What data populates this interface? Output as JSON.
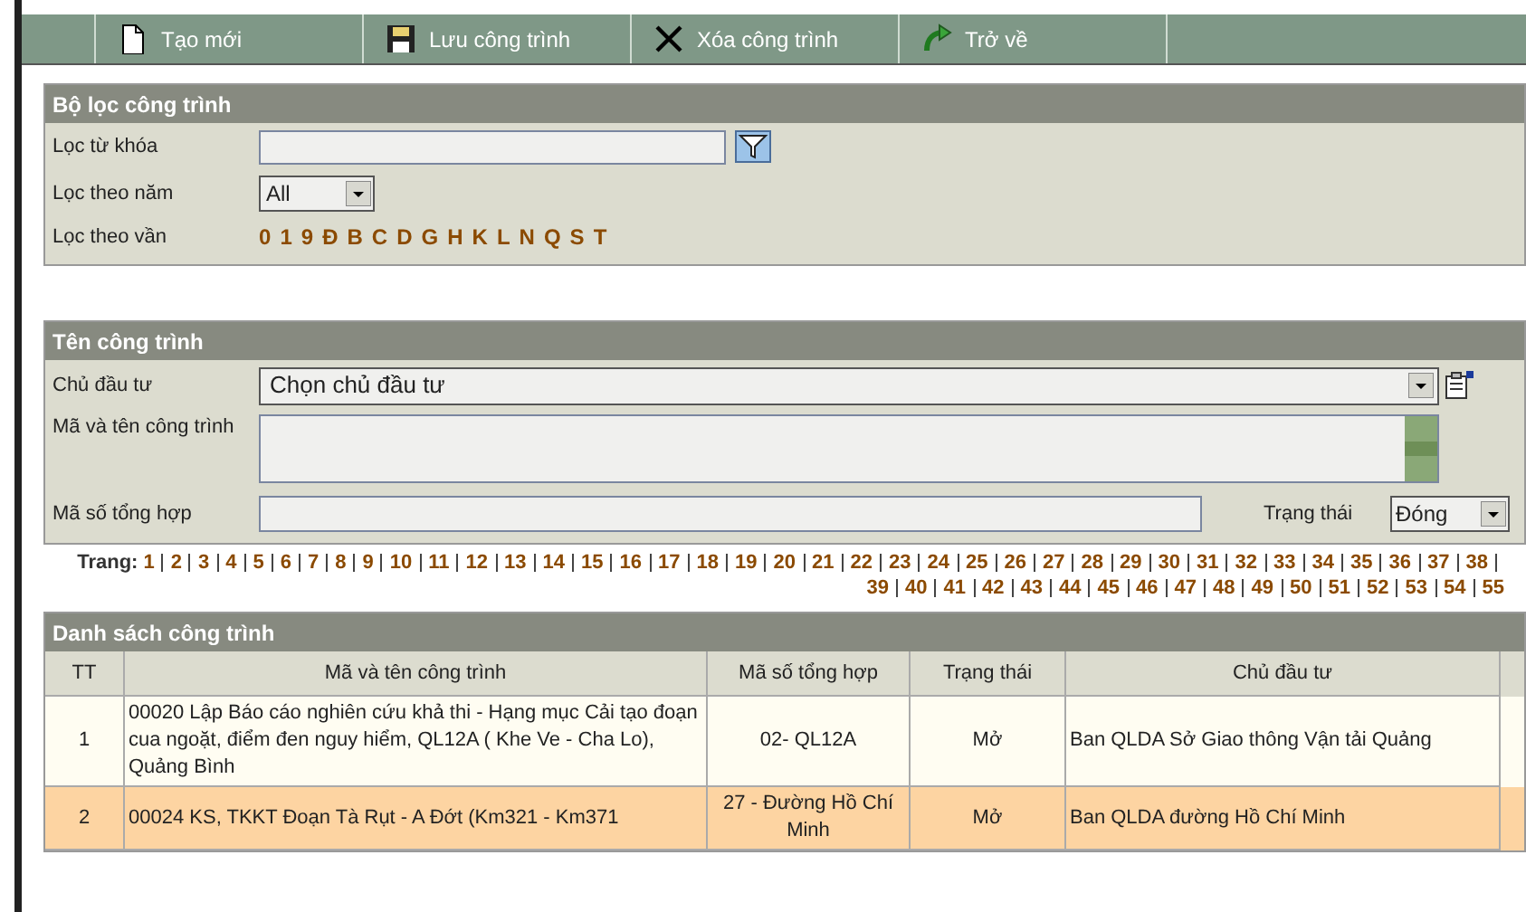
{
  "toolbar": [
    {
      "kind": "new",
      "label": "Tạo mới"
    },
    {
      "kind": "save",
      "label": "Lưu công trình"
    },
    {
      "kind": "delete",
      "label": "Xóa công trình"
    },
    {
      "kind": "back",
      "label": "Trở về"
    }
  ],
  "filter": {
    "title": "Bộ lọc công trình",
    "keyword_label": "Lọc từ khóa",
    "year_label": "Lọc theo năm",
    "year_value": "All",
    "letters_label": "Lọc theo vần",
    "letters": [
      "0",
      "1",
      "9",
      "Đ",
      "B",
      "C",
      "D",
      "G",
      "H",
      "K",
      "L",
      "N",
      "Q",
      "S",
      "T"
    ]
  },
  "project": {
    "title": "Tên công trình",
    "owner_label": "Chủ đầu tư",
    "owner_value": "Chọn chủ đầu tư",
    "name_label": "Mã và tên công trình",
    "code_label": "Mã số tổng hợp",
    "status_label": "Trạng thái",
    "status_value": "Đóng"
  },
  "pager": {
    "label": "Trang:",
    "pages": [
      "1",
      "2",
      "3",
      "4",
      "5",
      "6",
      "7",
      "8",
      "9",
      "10",
      "11",
      "12",
      "13",
      "14",
      "15",
      "16",
      "17",
      "18",
      "19",
      "20",
      "21",
      "22",
      "23",
      "24",
      "25",
      "26",
      "27",
      "28",
      "29",
      "30",
      "31",
      "32",
      "33",
      "34",
      "35",
      "36",
      "37",
      "38",
      "39",
      "40",
      "41",
      "42",
      "43",
      "44",
      "45",
      "46",
      "47",
      "48",
      "49",
      "50",
      "51",
      "52",
      "53",
      "54",
      "55"
    ]
  },
  "table": {
    "title": "Danh sách công trình",
    "columns": [
      "TT",
      "Mã và tên công trình",
      "Mã số tổng hợp",
      "Trạng thái",
      "Chủ đầu tư"
    ],
    "rows": [
      {
        "selected": false,
        "cells": [
          "1",
          "00020 Lập Báo cáo nghiên cứu khả thi - Hạng mục Cải tạo đoạn cua ngoặt, điểm đen nguy hiểm, QL12A ( Khe Ve - Cha Lo), Quảng Bình",
          "02- QL12A",
          "Mở",
          "Ban QLDA Sở Giao thông Vận tải Quảng"
        ]
      },
      {
        "selected": true,
        "cells": [
          "2",
          "00024 KS, TKKT Đoạn Tà Rụt - A Đớt (Km321 - Km371",
          "27 - Đường Hồ Chí Minh",
          "Mở",
          "Ban QLDA đường Hồ Chí Minh"
        ]
      }
    ]
  }
}
